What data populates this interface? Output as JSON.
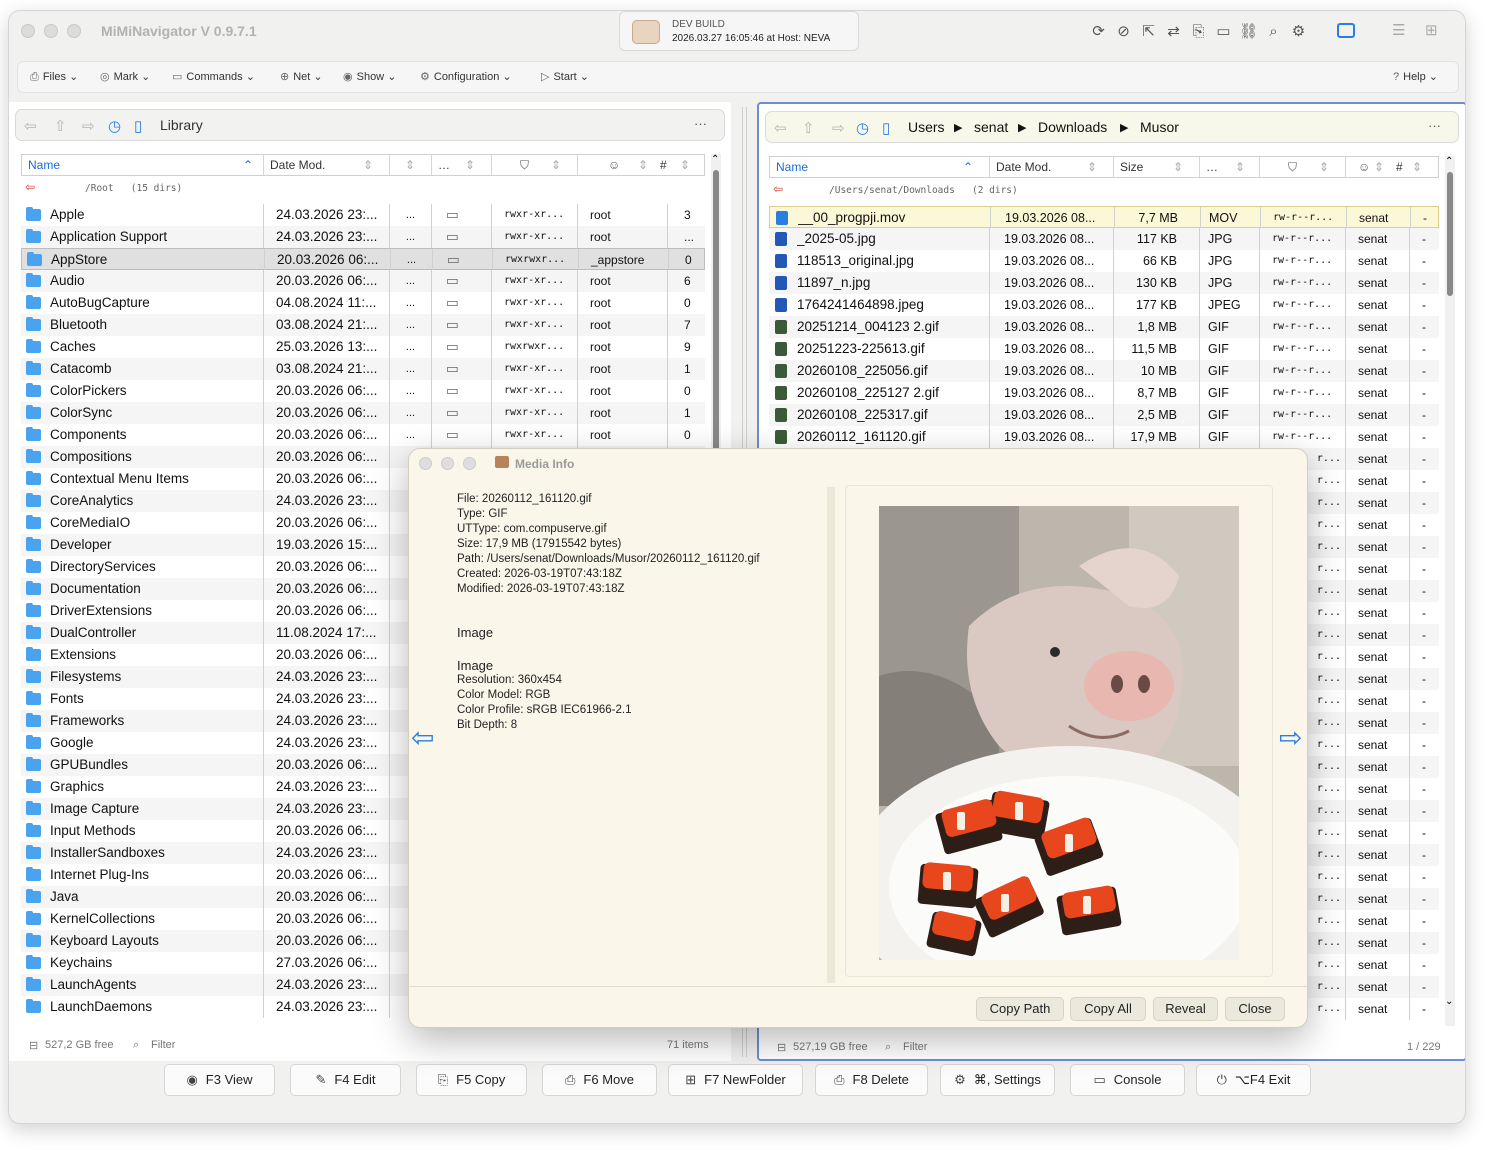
{
  "window": {
    "title": "MiMiNavigator V 0.9.7.1",
    "build_label": "DEV BUILD",
    "build_info": "2026.03.27 16:05:46 at Host: NEVA"
  },
  "menu": {
    "items": [
      "Files",
      "Mark",
      "Commands",
      "Net",
      "Show",
      "Configuration",
      "Start"
    ],
    "help": "Help"
  },
  "left": {
    "path": "Library",
    "more": "···",
    "headers": [
      "Name",
      "Date Mod.",
      "…",
      "#"
    ],
    "subpath": "/Root   (15 dirs)",
    "rows": [
      {
        "name": "Apple",
        "date": "24.03.2026 23:...",
        "dots": "...",
        "perm": "rwxr-xr...",
        "owner": "root",
        "count": "3",
        "icon": true
      },
      {
        "name": "Application Support",
        "date": "24.03.2026 23:...",
        "dots": "...",
        "perm": "rwxr-xr...",
        "owner": "root",
        "count": "...",
        "icon": true
      },
      {
        "name": "AppStore",
        "date": "20.03.2026 06:...",
        "dots": "...",
        "perm": "rwxrwxr...",
        "owner": "_appstore",
        "count": "0",
        "icon": true
      },
      {
        "name": "Audio",
        "date": "20.03.2026 06:...",
        "dots": "...",
        "perm": "rwxr-xr...",
        "owner": "root",
        "count": "6",
        "icon": true
      },
      {
        "name": "AutoBugCapture",
        "date": "04.08.2024 11:...",
        "dots": "...",
        "perm": "rwxr-xr...",
        "owner": "root",
        "count": "0",
        "icon": true
      },
      {
        "name": "Bluetooth",
        "date": "03.08.2024 21:...",
        "dots": "...",
        "perm": "rwxr-xr...",
        "owner": "root",
        "count": "7",
        "icon": true
      },
      {
        "name": "Caches",
        "date": "25.03.2026 13:...",
        "dots": "...",
        "perm": "rwxrwxr...",
        "owner": "root",
        "count": "9",
        "icon": true
      },
      {
        "name": "Catacomb",
        "date": "03.08.2024 21:...",
        "dots": "...",
        "perm": "rwxr-xr...",
        "owner": "root",
        "count": "1",
        "icon": true
      },
      {
        "name": "ColorPickers",
        "date": "20.03.2026 06:...",
        "dots": "...",
        "perm": "rwxr-xr...",
        "owner": "root",
        "count": "0",
        "icon": true
      },
      {
        "name": "ColorSync",
        "date": "20.03.2026 06:...",
        "dots": "...",
        "perm": "rwxr-xr...",
        "owner": "root",
        "count": "1",
        "icon": true
      },
      {
        "name": "Components",
        "date": "20.03.2026 06:...",
        "dots": "...",
        "perm": "rwxr-xr...",
        "owner": "root",
        "count": "0",
        "icon": true
      },
      {
        "name": "Compositions",
        "date": "20.03.2026 06:...",
        "dots": "",
        "perm": "",
        "owner": "",
        "count": "",
        "icon": false
      },
      {
        "name": "Contextual Menu Items",
        "date": "20.03.2026 06:...",
        "dots": "",
        "perm": "",
        "owner": "",
        "count": "",
        "icon": false
      },
      {
        "name": "CoreAnalytics",
        "date": "24.03.2026 23:...",
        "dots": "",
        "perm": "",
        "owner": "",
        "count": "",
        "icon": false
      },
      {
        "name": "CoreMediaIO",
        "date": "20.03.2026 06:...",
        "dots": "",
        "perm": "",
        "owner": "",
        "count": "",
        "icon": false
      },
      {
        "name": "Developer",
        "date": "19.03.2026 15:...",
        "dots": "",
        "perm": "",
        "owner": "",
        "count": "",
        "icon": false
      },
      {
        "name": "DirectoryServices",
        "date": "20.03.2026 06:...",
        "dots": "",
        "perm": "",
        "owner": "",
        "count": "",
        "icon": false
      },
      {
        "name": "Documentation",
        "date": "20.03.2026 06:...",
        "dots": "",
        "perm": "",
        "owner": "",
        "count": "",
        "icon": false
      },
      {
        "name": "DriverExtensions",
        "date": "20.03.2026 06:...",
        "dots": "",
        "perm": "",
        "owner": "",
        "count": "",
        "icon": false
      },
      {
        "name": "DualController",
        "date": "11.08.2024 17:...",
        "dots": "",
        "perm": "",
        "owner": "",
        "count": "",
        "icon": false
      },
      {
        "name": "Extensions",
        "date": "20.03.2026 06:...",
        "dots": "",
        "perm": "",
        "owner": "",
        "count": "",
        "icon": false
      },
      {
        "name": "Filesystems",
        "date": "24.03.2026 23:...",
        "dots": "",
        "perm": "",
        "owner": "",
        "count": "",
        "icon": false
      },
      {
        "name": "Fonts",
        "date": "24.03.2026 23:...",
        "dots": "",
        "perm": "",
        "owner": "",
        "count": "",
        "icon": false
      },
      {
        "name": "Frameworks",
        "date": "24.03.2026 23:...",
        "dots": "",
        "perm": "",
        "owner": "",
        "count": "",
        "icon": false
      },
      {
        "name": "Google",
        "date": "24.03.2026 23:...",
        "dots": "",
        "perm": "",
        "owner": "",
        "count": "",
        "icon": false
      },
      {
        "name": "GPUBundles",
        "date": "20.03.2026 06:...",
        "dots": "",
        "perm": "",
        "owner": "",
        "count": "",
        "icon": false
      },
      {
        "name": "Graphics",
        "date": "24.03.2026 23:...",
        "dots": "",
        "perm": "",
        "owner": "",
        "count": "",
        "icon": false
      },
      {
        "name": "Image Capture",
        "date": "24.03.2026 23:...",
        "dots": "",
        "perm": "",
        "owner": "",
        "count": "",
        "icon": false
      },
      {
        "name": "Input Methods",
        "date": "20.03.2026 06:...",
        "dots": "",
        "perm": "",
        "owner": "",
        "count": "",
        "icon": false
      },
      {
        "name": "InstallerSandboxes",
        "date": "24.03.2026 23:...",
        "dots": "",
        "perm": "",
        "owner": "",
        "count": "",
        "icon": false
      },
      {
        "name": "Internet Plug-Ins",
        "date": "20.03.2026 06:...",
        "dots": "",
        "perm": "",
        "owner": "",
        "count": "",
        "icon": false
      },
      {
        "name": "Java",
        "date": "20.03.2026 06:...",
        "dots": "",
        "perm": "",
        "owner": "",
        "count": "",
        "icon": false
      },
      {
        "name": "KernelCollections",
        "date": "20.03.2026 06:...",
        "dots": "",
        "perm": "",
        "owner": "",
        "count": "",
        "icon": false
      },
      {
        "name": "Keyboard Layouts",
        "date": "20.03.2026 06:...",
        "dots": "",
        "perm": "",
        "owner": "",
        "count": "",
        "icon": false
      },
      {
        "name": "Keychains",
        "date": "27.03.2026 06:...",
        "dots": "",
        "perm": "",
        "owner": "",
        "count": "",
        "icon": false
      },
      {
        "name": "LaunchAgents",
        "date": "24.03.2026 23:...",
        "dots": "",
        "perm": "",
        "owner": "",
        "count": "",
        "icon": false
      },
      {
        "name": "LaunchDaemons",
        "date": "24.03.2026 23:...",
        "dots": "",
        "perm": "",
        "owner": "",
        "count": "",
        "icon": false
      }
    ],
    "status_free": "527,2 GB free",
    "status_filter": "Filter",
    "status_count": "71 items"
  },
  "right": {
    "path": [
      "Users",
      "senat",
      "Downloads",
      "Musor"
    ],
    "more": "···",
    "headers": [
      "Name",
      "Date Mod.",
      "Size",
      "…",
      "#"
    ],
    "subpath": "/Users/senat/Downloads   (2 dirs)",
    "rows": [
      {
        "name": "__00_progpji.mov",
        "date": "19.03.2026 08...",
        "size": "7,7 MB",
        "kind": "MOV",
        "perm": "rw-r--r...",
        "owner": "senat",
        "count": "-"
      },
      {
        "name": "_2025-05.jpg",
        "date": "19.03.2026 08...",
        "size": "117 KB",
        "kind": "JPG",
        "perm": "rw-r--r...",
        "owner": "senat",
        "count": "-"
      },
      {
        "name": "118513_original.jpg",
        "date": "19.03.2026 08...",
        "size": "66 KB",
        "kind": "JPG",
        "perm": "rw-r--r...",
        "owner": "senat",
        "count": "-"
      },
      {
        "name": "11897_n.jpg",
        "date": "19.03.2026 08...",
        "size": "130 KB",
        "kind": "JPG",
        "perm": "rw-r--r...",
        "owner": "senat",
        "count": "-"
      },
      {
        "name": "1764241464898.jpeg",
        "date": "19.03.2026 08...",
        "size": "177 KB",
        "kind": "JPEG",
        "perm": "rw-r--r...",
        "owner": "senat",
        "count": "-"
      },
      {
        "name": "20251214_004123 2.gif",
        "date": "19.03.2026 08...",
        "size": "1,8 MB",
        "kind": "GIF",
        "perm": "rw-r--r...",
        "owner": "senat",
        "count": "-"
      },
      {
        "name": "20251223-225613.gif",
        "date": "19.03.2026 08...",
        "size": "11,5 MB",
        "kind": "GIF",
        "perm": "rw-r--r...",
        "owner": "senat",
        "count": "-"
      },
      {
        "name": "20260108_225056.gif",
        "date": "19.03.2026 08...",
        "size": "10 MB",
        "kind": "GIF",
        "perm": "rw-r--r...",
        "owner": "senat",
        "count": "-"
      },
      {
        "name": "20260108_225127 2.gif",
        "date": "19.03.2026 08...",
        "size": "8,7 MB",
        "kind": "GIF",
        "perm": "rw-r--r...",
        "owner": "senat",
        "count": "-"
      },
      {
        "name": "20260108_225317.gif",
        "date": "19.03.2026 08...",
        "size": "2,5 MB",
        "kind": "GIF",
        "perm": "rw-r--r...",
        "owner": "senat",
        "count": "-"
      },
      {
        "name": "20260112_161120.gif",
        "date": "19.03.2026 08...",
        "size": "17,9 MB",
        "kind": "GIF",
        "perm": "rw-r--r...",
        "owner": "senat",
        "count": "-"
      }
    ],
    "peek_perm": "r...",
    "peek_owner": "senat",
    "peek_count": "-",
    "status_free": "527,19 GB free",
    "status_filter": "Filter",
    "status_count": "1 / 229"
  },
  "dialog": {
    "title": "Media Info",
    "lines": [
      "File: 20260112_161120.gif",
      "Type: GIF",
      "UTType: com.compuserve.gif",
      "Size: 17,9 MB (17915542 bytes)",
      "Path: /Users/senat/Downloads/Musor/20260112_161120.gif",
      "Created: 2026-03-19T07:43:18Z",
      "Modified: 2026-03-19T07:43:18Z"
    ],
    "section1": "Image",
    "section2": "Image",
    "image_lines": [
      "Resolution: 360x454",
      "Color Model: RGB",
      "Color Profile: sRGB IEC61966-2.1",
      "Bit Depth: 8"
    ],
    "buttons": [
      "Copy Path",
      "Copy All",
      "Reveal",
      "Close"
    ]
  },
  "fkeys": [
    "F3 View",
    "F4 Edit",
    "F5 Copy",
    "F6 Move",
    "F7 NewFolder",
    "F8 Delete",
    "⌘, Settings",
    "Console",
    "⌥F4 Exit"
  ],
  "colors": {
    "accent": "#2a7de1",
    "folder": "#4aa3ef",
    "highlight_row": "#fbf8d8",
    "dialog_bg": "#faf7ea"
  }
}
